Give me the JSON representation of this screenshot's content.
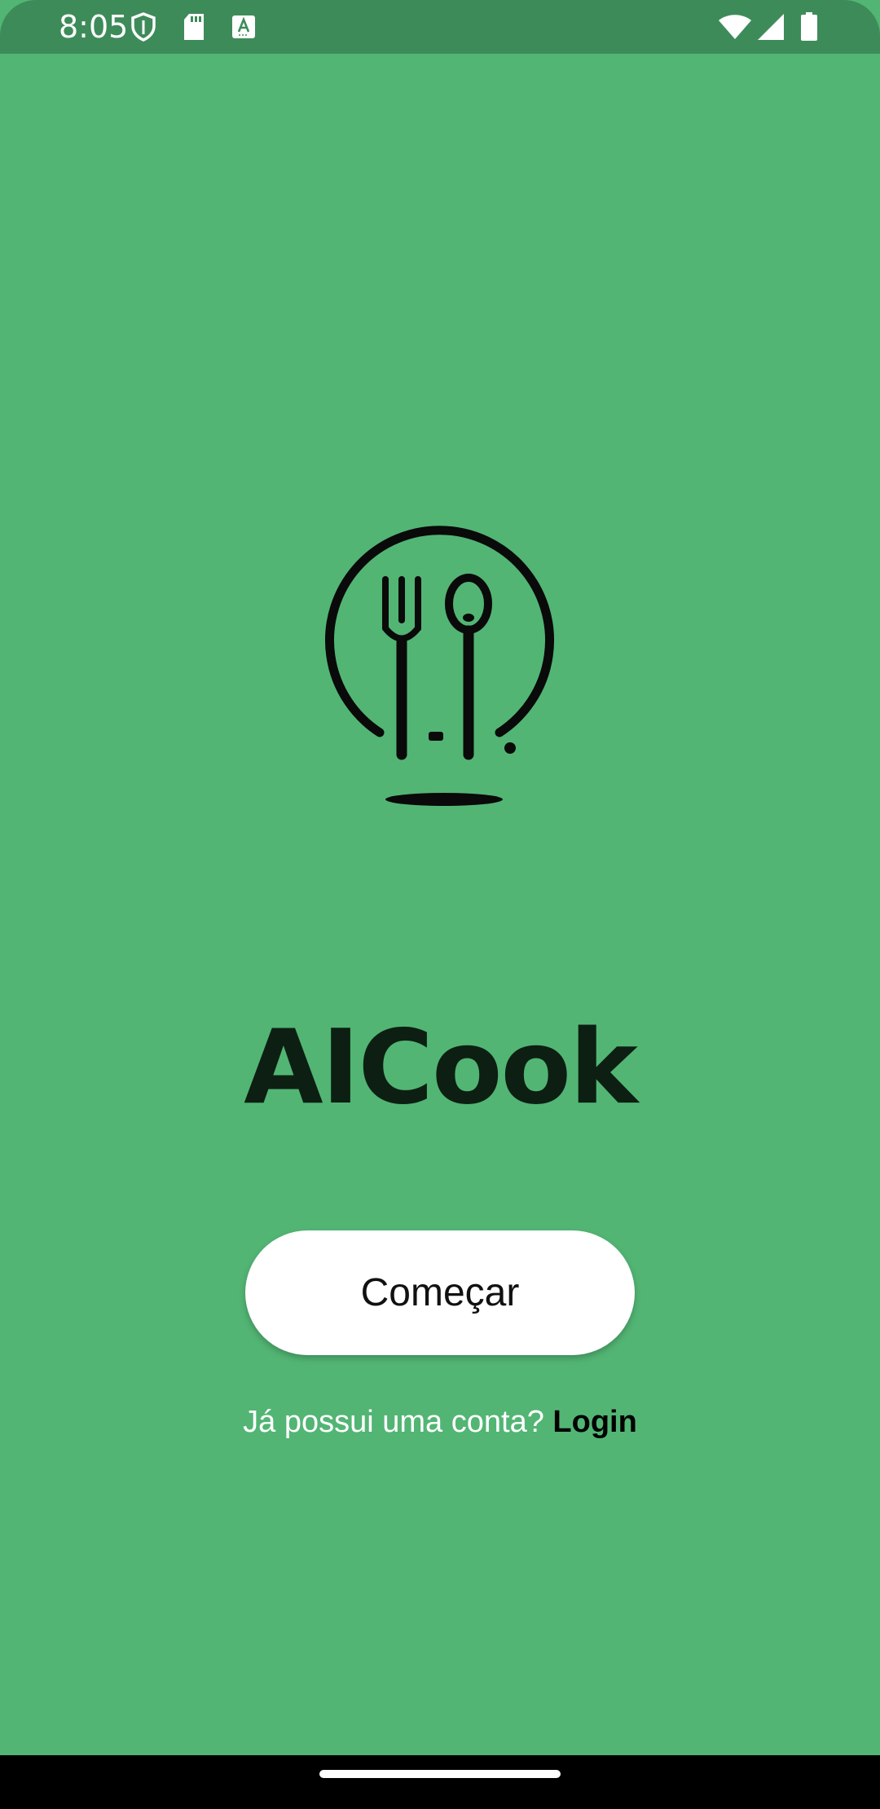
{
  "status_bar": {
    "time": "8:05",
    "left_icons": [
      "shield-icon",
      "sd-card-icon",
      "text-a-icon"
    ],
    "right_icons": [
      "wifi-icon",
      "signal-icon",
      "battery-icon"
    ]
  },
  "logo": {
    "icon": "fork-spoon-plate-icon"
  },
  "brand": {
    "name": "AICook"
  },
  "actions": {
    "start_label": "Começar",
    "login_prompt": "Já possui uma conta?",
    "login_link": "Login"
  },
  "colors": {
    "background": "#52b574",
    "status_bar": "#3e8b5a",
    "button": "#ffffff",
    "brand_text": "#0d1f12"
  }
}
